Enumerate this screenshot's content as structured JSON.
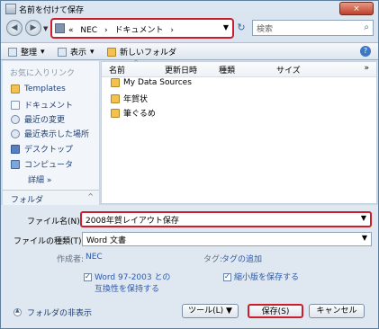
{
  "window": {
    "title": "名前を付けて保存",
    "close_label": "×"
  },
  "nav": {
    "back_label": "◀",
    "forward_label": "▶",
    "path": [
      "«",
      "NEC",
      "›",
      "ドキュメント",
      "›"
    ],
    "search_placeholder": "検索"
  },
  "toolbar": {
    "organize_label": "整理",
    "view_label": "表示",
    "new_folder_label": "新しいフォルダ",
    "help_label": "?"
  },
  "left_panel": {
    "header": "お気に入りリンク",
    "items": [
      {
        "label": "Templates",
        "icon": "folder-icon"
      },
      {
        "label": "ドキュメント",
        "icon": "documents-icon"
      },
      {
        "label": "最近の変更",
        "icon": "recent-changes-icon"
      },
      {
        "label": "最近表示した場所",
        "icon": "recent-places-icon"
      },
      {
        "label": "デスクトップ",
        "icon": "desktop-icon"
      },
      {
        "label": "コンピュータ",
        "icon": "computer-icon"
      }
    ],
    "more_label": "詳細",
    "more_chevron": "»",
    "folder_label": "フォルダ",
    "folder_chevron": "^"
  },
  "file_list": {
    "columns": [
      "名前",
      "更新日時",
      "種類",
      "サイズ",
      "»"
    ],
    "files": [
      {
        "name": "My Data Sources",
        "icon": "folder-icon"
      },
      {
        "name": "年賀状",
        "icon": "folder-icon"
      },
      {
        "name": "筆ぐるめ",
        "icon": "folder-icon"
      }
    ]
  },
  "save_form": {
    "filename_label": "ファイル名(N):",
    "filename_value": "2008年賀レイアウト保存",
    "filetype_label": "ファイルの種類(T):",
    "filetype_value": "Word 文書",
    "author_label": "作成者:",
    "author_value": "NEC",
    "tag_label": "タグ:",
    "tag_value": "タグの追加",
    "compat_label_1": "Word 97-2003 との",
    "compat_label_2": "互換性を保持する",
    "thumbnail_label": "縮小版を保存する"
  },
  "footer": {
    "hide_folders_label": "フォルダの非表示",
    "tools_label": "ツール(L)",
    "tools_arrow": "▼",
    "save_label": "保存(S)",
    "cancel_label": "キャンセル"
  },
  "colors": {
    "highlight": "#cc1d2d",
    "link": "#2d58a8",
    "window_bg": "#dfe8f1"
  }
}
